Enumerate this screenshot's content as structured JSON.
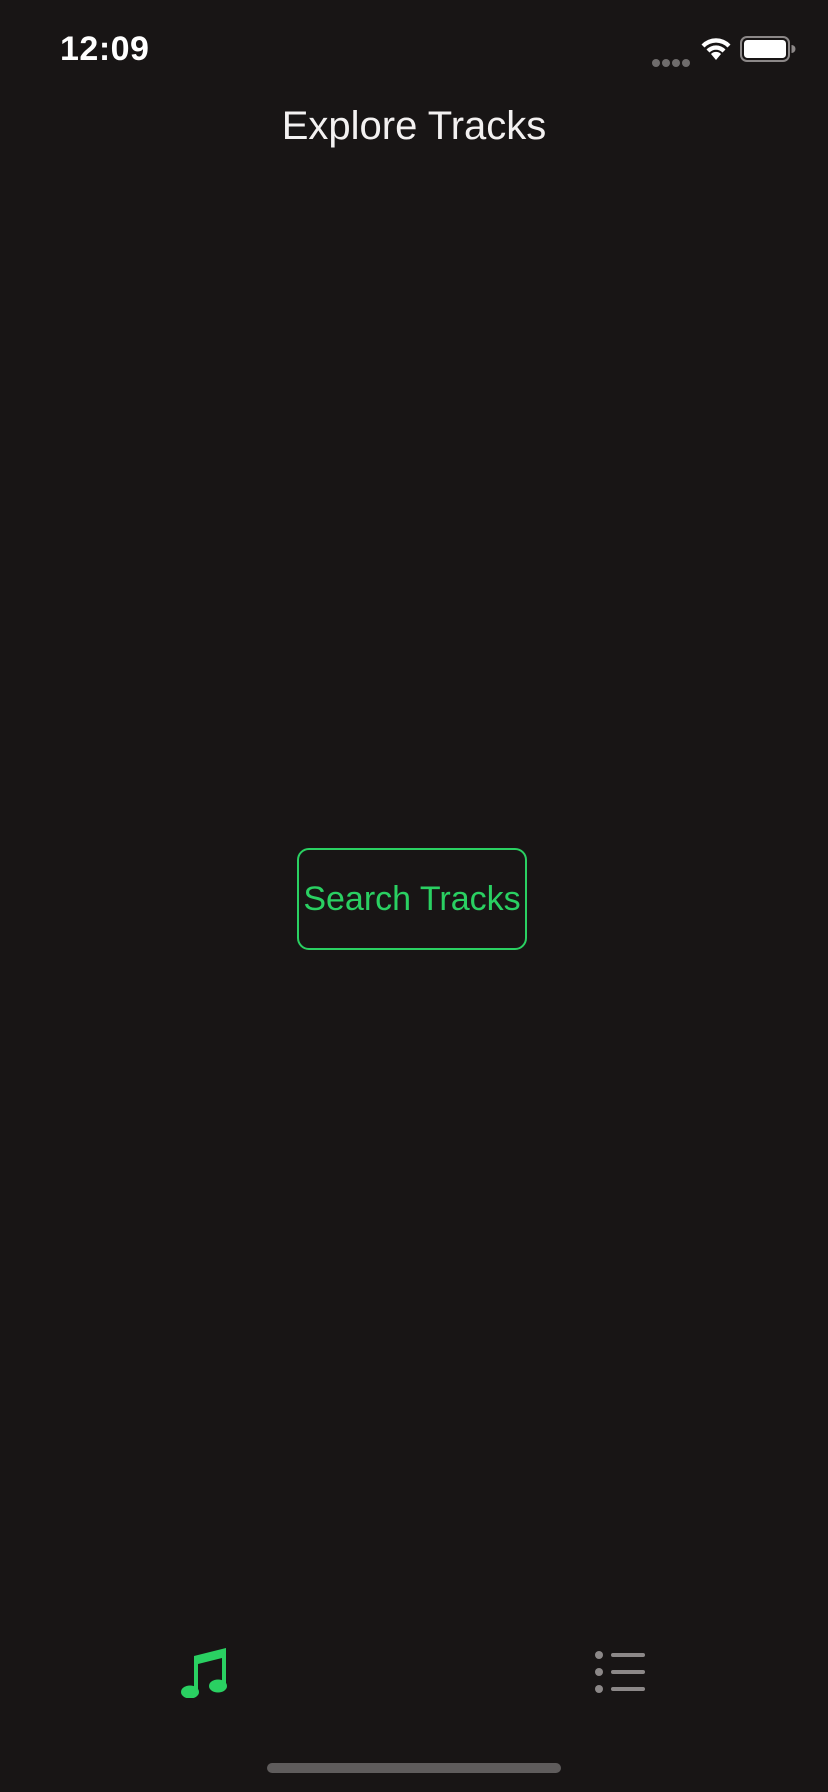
{
  "status_bar": {
    "time": "12:09",
    "icons": [
      "signal-dots-icon",
      "wifi-icon",
      "battery-icon"
    ]
  },
  "nav": {
    "title": "Explore Tracks"
  },
  "main": {
    "search_button_label": "Search Tracks"
  },
  "tab_bar": {
    "items": [
      {
        "icon": "music-note-icon",
        "selected": true
      },
      {
        "icon": "list-icon",
        "selected": false
      }
    ]
  },
  "colors": {
    "background": "#181515",
    "accent": "#2ad062",
    "inactive": "#8c8888",
    "text": "#f3f1f1"
  }
}
